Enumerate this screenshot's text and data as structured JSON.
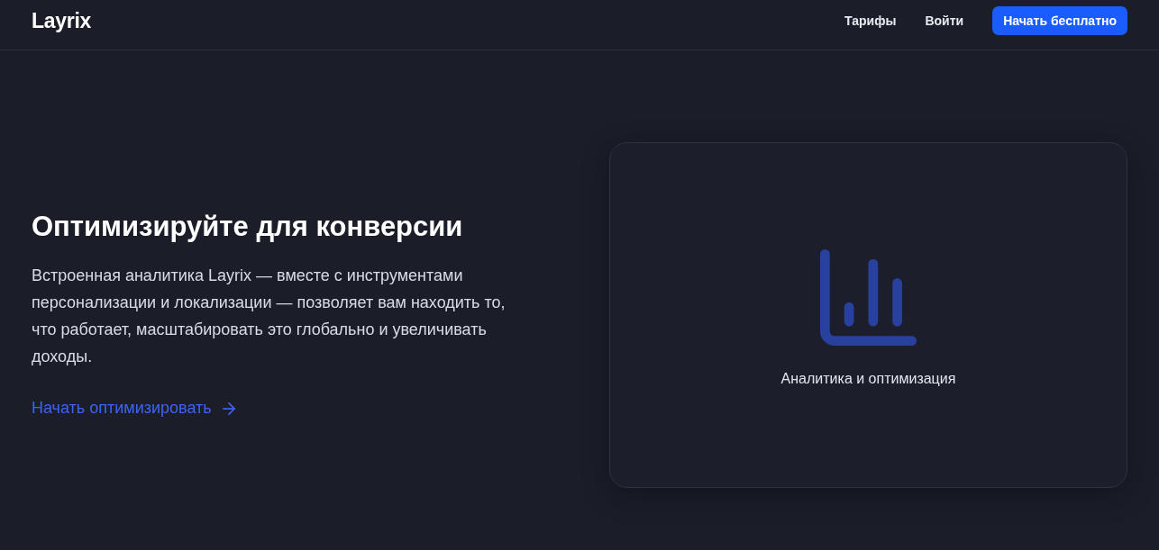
{
  "header": {
    "logo": "Layrix",
    "nav": [
      "Тарифы",
      "Войти"
    ],
    "cta": "Начать бесплатно"
  },
  "hero": {
    "title": "Оптимизируйте для конверсии",
    "description": "Встроенная аналитика Layrix — вместе с инструментами персонализации и локализации — позволяет вам находить то, что работает, масштабировать это глобально и увеличивать доходы.",
    "link": "Начать оптимизировать",
    "card": {
      "caption": "Аналитика и оптимизация"
    }
  }
}
